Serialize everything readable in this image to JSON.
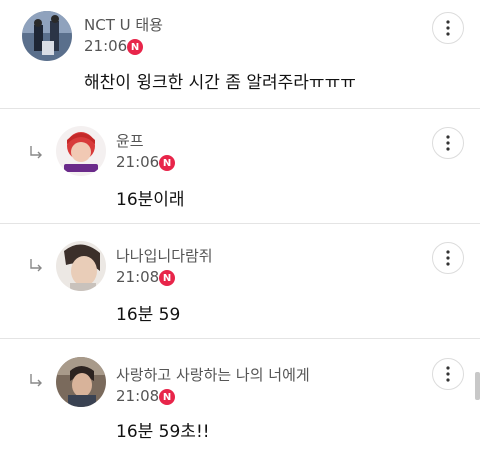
{
  "comments": [
    {
      "author": "NCT U 태용",
      "time": "21:06",
      "new_badge": "N",
      "text": "해찬이 윙크한 시간 좀 알려주라ㅠㅠㅠ",
      "is_reply": false
    },
    {
      "author": "윤프",
      "time": "21:06",
      "new_badge": "N",
      "text": "16분이래",
      "is_reply": true
    },
    {
      "author": "나나입니다람쥐",
      "time": "21:08",
      "new_badge": "N",
      "text": "16분 59",
      "is_reply": true
    },
    {
      "author": "사랑하고 사랑하는 나의 너에게",
      "time": "21:08",
      "new_badge": "N",
      "text": "16분 59초!!",
      "is_reply": true
    }
  ],
  "icons": {
    "more": "more-vertical-icon",
    "reply": "reply-arrow-icon"
  },
  "colors": {
    "badge": "#e8254a",
    "meta_text": "#555555",
    "divider": "#e4e4e4"
  }
}
